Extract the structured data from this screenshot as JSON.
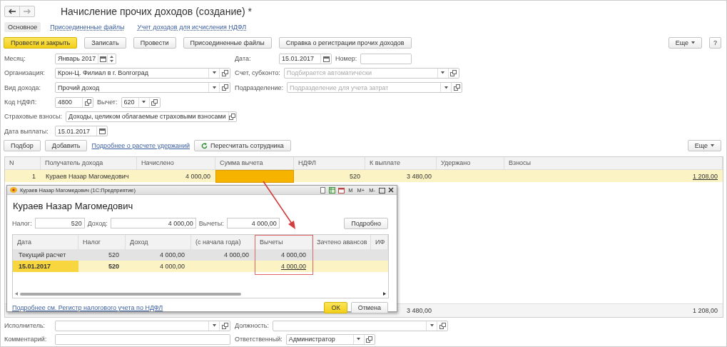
{
  "window": {
    "title": "Начисление прочих доходов (создание) *"
  },
  "tabs": [
    {
      "label": "Основное",
      "selected": true
    },
    {
      "label": "Присоединенные файлы",
      "selected": false
    },
    {
      "label": "Учет доходов для исчисления НДФЛ",
      "selected": false
    }
  ],
  "toolbar": {
    "buttons": [
      {
        "label": "Провести и закрыть",
        "default": true
      },
      {
        "label": "Записать",
        "default": false
      },
      {
        "label": "Провести",
        "default": false
      },
      {
        "label": "Присоединенные файлы",
        "default": false
      },
      {
        "label": "Справка о регистрации прочих доходов",
        "default": false
      }
    ],
    "more": "Еще",
    "help": "?"
  },
  "form": {
    "rows": [
      {
        "left": [
          {
            "kind": "label",
            "text": "Месяц:"
          },
          {
            "kind": "month",
            "value": "Январь 2017"
          }
        ],
        "right": [
          {
            "kind": "label",
            "text": "Дата:"
          },
          {
            "kind": "date",
            "value": "15.01.2017"
          },
          {
            "kind": "label",
            "text": "Номер:"
          },
          {
            "kind": "number"
          }
        ]
      },
      {
        "left": [
          {
            "kind": "label",
            "text": "Организация:"
          },
          {
            "kind": "reference",
            "value": "Крон-Ц. Филиал в г. Волгоград"
          }
        ],
        "right": [
          {
            "kind": "label",
            "text": "Счет, субконто:"
          },
          {
            "kind": "reference",
            "placeholder": "Подбирается автоматически"
          }
        ]
      },
      {
        "left": [
          {
            "kind": "label",
            "text": "Вид дохода:"
          },
          {
            "kind": "reference",
            "value": "Прочий доход"
          }
        ],
        "right": [
          {
            "kind": "label",
            "text": "Подразделение:"
          },
          {
            "kind": "reference",
            "placeholder": "Подразделение для учета затрат"
          }
        ]
      },
      {
        "left": [
          {
            "kind": "label",
            "text": "Код НДФЛ:"
          },
          {
            "kind": "code",
            "value": "4800"
          },
          {
            "kind": "label",
            "text": "Вычет:"
          },
          {
            "kind": "code-select",
            "value": "620"
          }
        ]
      },
      {
        "left": [
          {
            "kind": "label",
            "text": "Страховые взносы:"
          },
          {
            "kind": "category",
            "value": "Доходы, целиком облагаемые страховыми взносами"
          }
        ]
      },
      {
        "left": [
          {
            "kind": "label",
            "text": "Дата выплаты:"
          },
          {
            "kind": "date",
            "value": "15.01.2017"
          }
        ]
      }
    ]
  },
  "table_toolbar": {
    "buttons": [
      "Подбор",
      "Добавить"
    ],
    "link": "Подробнее о расчете удержаний",
    "recalc": "Пересчитать сотрудника",
    "more": "Еще"
  },
  "table": {
    "columns": [
      "N",
      "Получатель дохода",
      "Начислено",
      "Сумма вычета",
      "НДФЛ",
      "К выплате",
      "Удержано",
      "Взносы"
    ],
    "rows": [
      {
        "selected": true,
        "cells": [
          {
            "kind": "number",
            "text": "1",
            "selected": false
          },
          {
            "kind": "text",
            "text": "Кураев Назар Магомедович",
            "selected": false
          },
          {
            "kind": "number",
            "text": "4 000,00",
            "selected": false
          },
          {
            "kind": "number",
            "selected": true
          },
          {
            "kind": "number",
            "text": "520",
            "selected": false
          },
          {
            "kind": "number",
            "text": "3 480,00",
            "selected": false
          },
          {
            "kind": "blank",
            "selected": false
          },
          {
            "kind": "link",
            "text": "1 208,00",
            "selected": false
          }
        ]
      }
    ],
    "footer": [
      {
        "kind": "blank"
      },
      {
        "kind": "blank"
      },
      {
        "kind": "blank"
      },
      {
        "kind": "blank"
      },
      {
        "kind": "blank"
      },
      {
        "kind": "total",
        "text": "3 480,00"
      },
      {
        "kind": "blank"
      },
      {
        "kind": "total",
        "text": "1 208,00"
      }
    ]
  },
  "dialog": {
    "title": "Кураев Назар Магомедович (1С:Предприятие)",
    "memory": [
      "M",
      "M+",
      "M-"
    ],
    "heading": "Кураев Назар Магомедович",
    "fields": [
      {
        "label": "Налог:",
        "value": "520"
      },
      {
        "label": "Доход:",
        "value": "4 000,00"
      },
      {
        "label": "Вычеты:",
        "value": "4 000,00"
      }
    ],
    "details_button": "Подробно",
    "table": {
      "columns": [
        "Дата",
        "Налог",
        "Доход",
        "(с начала года)",
        "Вычеты",
        "Зачтено авансов",
        "ИФ"
      ],
      "rows": [
        {
          "kind": "current",
          "selected": false,
          "cells": [
            {
              "kind": "text",
              "text": "Текущий расчет"
            },
            {
              "kind": "number",
              "text": "520"
            },
            {
              "kind": "number",
              "text": "4 000,00"
            },
            {
              "kind": "number",
              "text": "4 000,00"
            },
            {
              "kind": "number",
              "text": "4 000,00"
            },
            {
              "kind": "blank"
            },
            {
              "kind": "blank"
            }
          ]
        },
        {
          "kind": "entry",
          "selected": true,
          "cells": [
            {
              "kind": "bold",
              "text": "15.01.2017"
            },
            {
              "kind": "bold",
              "text": "520"
            },
            {
              "kind": "number",
              "text": "4 000,00"
            },
            {
              "kind": "blank"
            },
            {
              "kind": "link",
              "text": "4 000,00"
            },
            {
              "kind": "blank"
            },
            {
              "kind": "blank"
            }
          ]
        }
      ]
    },
    "link": "Подробнее см. Регистр налогового учета по НДФЛ",
    "buttons": [
      {
        "label": "ОК",
        "default": true
      },
      {
        "label": "Отмена",
        "default": false
      }
    ]
  },
  "bottom": {
    "rows": [
      {
        "left": [
          {
            "kind": "label",
            "text": "Исполнитель:"
          },
          {
            "kind": "reference"
          }
        ],
        "right": [
          {
            "kind": "label",
            "text": "Должность:"
          },
          {
            "kind": "reference"
          }
        ]
      },
      {
        "left": [
          {
            "kind": "label",
            "text": "Комментарий:"
          },
          {
            "kind": "text"
          }
        ],
        "right": [
          {
            "kind": "label",
            "text": "Ответственный:"
          },
          {
            "kind": "short-reference",
            "value": "Администратор"
          }
        ]
      }
    ]
  }
}
